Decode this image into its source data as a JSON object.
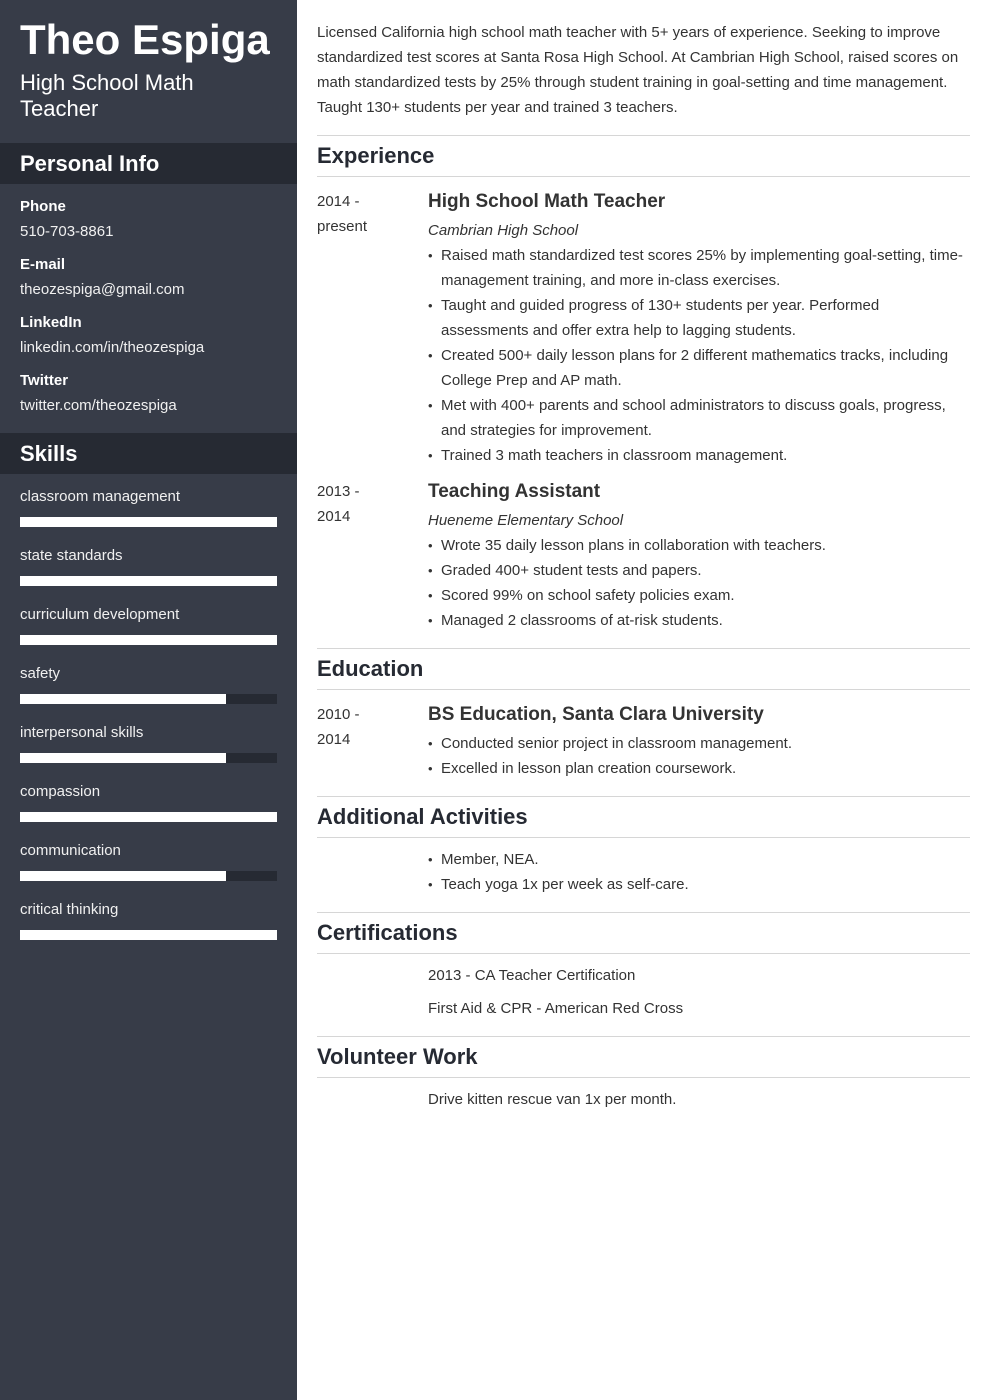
{
  "profile": {
    "name": "Theo Espiga",
    "title": "High School Math Teacher"
  },
  "personal_info": {
    "heading": "Personal Info",
    "items": [
      {
        "label": "Phone",
        "value": "510-703-8861"
      },
      {
        "label": "E-mail",
        "value": "theozespiga@gmail.com"
      },
      {
        "label": "LinkedIn",
        "value": "linkedin.com/in/theozespiga"
      },
      {
        "label": "Twitter",
        "value": "twitter.com/theozespiga"
      }
    ]
  },
  "skills": {
    "heading": "Skills",
    "items": [
      {
        "name": "classroom management",
        "level": 1.0
      },
      {
        "name": "state standards",
        "level": 1.0
      },
      {
        "name": "curriculum development",
        "level": 1.0
      },
      {
        "name": "safety",
        "level": 0.8
      },
      {
        "name": "interpersonal skills",
        "level": 0.8
      },
      {
        "name": "compassion",
        "level": 1.0
      },
      {
        "name": "communication",
        "level": 0.8
      },
      {
        "name": "critical thinking",
        "level": 1.0
      }
    ]
  },
  "summary": "Licensed California high school math teacher with 5+ years of experience. Seeking to improve standardized test scores at Santa Rosa High School. At Cambrian High School, raised scores on math standardized tests by 25% through student training in goal-setting and time management. Taught 130+ students per year and trained 3 teachers.",
  "experience": {
    "heading": "Experience",
    "entries": [
      {
        "date_start": "2014 -",
        "date_end": "present",
        "title": "High School Math Teacher",
        "organization": "Cambrian High School",
        "bullets": [
          "Raised math standardized test scores 25% by implementing goal-setting, time-management training, and more in-class exercises.",
          "Taught and guided progress of 130+ students per year. Performed assessments and offer extra help to lagging students.",
          "Created 500+ daily lesson plans for 2 different mathematics tracks, including College Prep and AP math.",
          "Met with 400+ parents and school administrators to discuss goals, progress, and strategies for improvement.",
          "Trained 3 math teachers in classroom management."
        ]
      },
      {
        "date_start": "2013 -",
        "date_end": "2014",
        "title": "Teaching Assistant",
        "organization": "Hueneme Elementary School",
        "bullets": [
          "Wrote 35 daily lesson plans in collaboration with teachers.",
          "Graded 400+ student tests and papers.",
          "Scored 99% on school safety policies exam.",
          "Managed 2 classrooms of at-risk students."
        ]
      }
    ]
  },
  "education": {
    "heading": "Education",
    "entries": [
      {
        "date_start": "2010 -",
        "date_end": "2014",
        "title": "BS Education, Santa Clara University",
        "bullets": [
          "Conducted senior project in classroom management.",
          "Excelled in lesson plan creation coursework."
        ]
      }
    ]
  },
  "additional_activities": {
    "heading": "Additional Activities",
    "bullets": [
      "Member, NEA.",
      "Teach yoga 1x per week as self-care."
    ]
  },
  "certifications": {
    "heading": "Certifications",
    "items": [
      "2013 - CA Teacher Certification",
      "First Aid & CPR - American Red Cross"
    ]
  },
  "volunteer_work": {
    "heading": "Volunteer Work",
    "items": [
      "Drive kitten rescue van 1x per month."
    ]
  },
  "colors": {
    "sidebar_bg": "#373c48",
    "sidebar_header_bg": "#262a33",
    "text": "#333333",
    "heading": "#262a33",
    "rule": "#d6d6d6"
  }
}
